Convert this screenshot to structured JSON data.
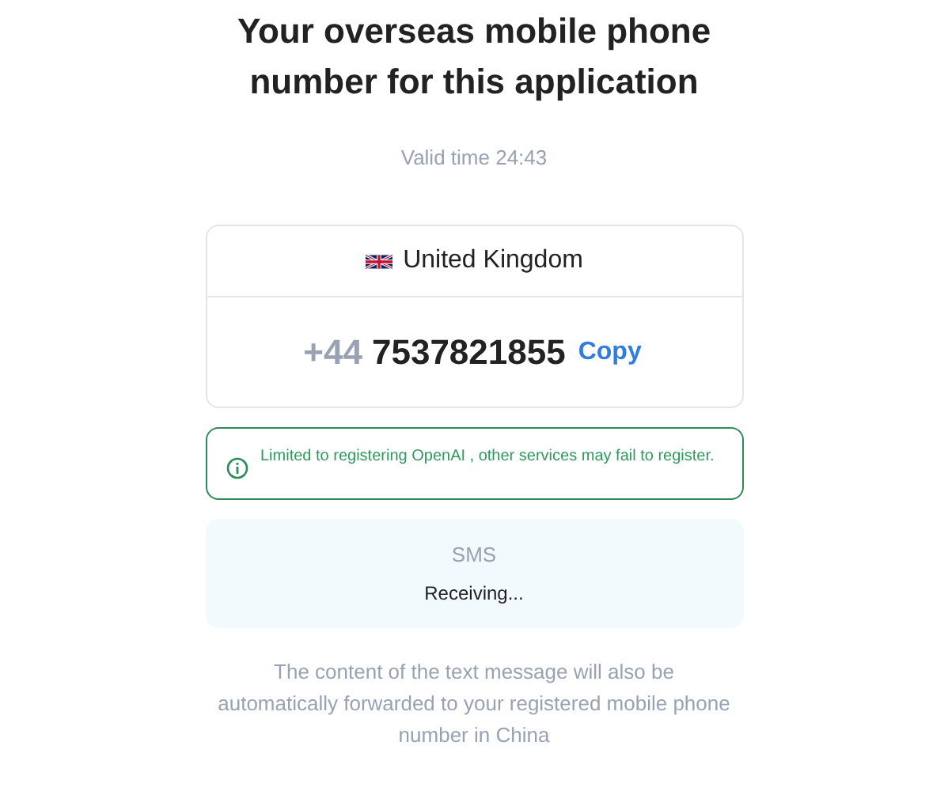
{
  "title": "Your overseas mobile phone number for this application",
  "valid_time": "Valid time 24:43",
  "number_card": {
    "country": "United Kingdom",
    "country_code": "+44",
    "number": "7537821855",
    "copy_label": "Copy"
  },
  "notice": {
    "text": "Limited to registering OpenAI , other services may fail to register."
  },
  "sms": {
    "label": "SMS",
    "status": "Receiving..."
  },
  "footer": "The content of the text message will also be automatically forwarded to your registered mobile phone number in China"
}
